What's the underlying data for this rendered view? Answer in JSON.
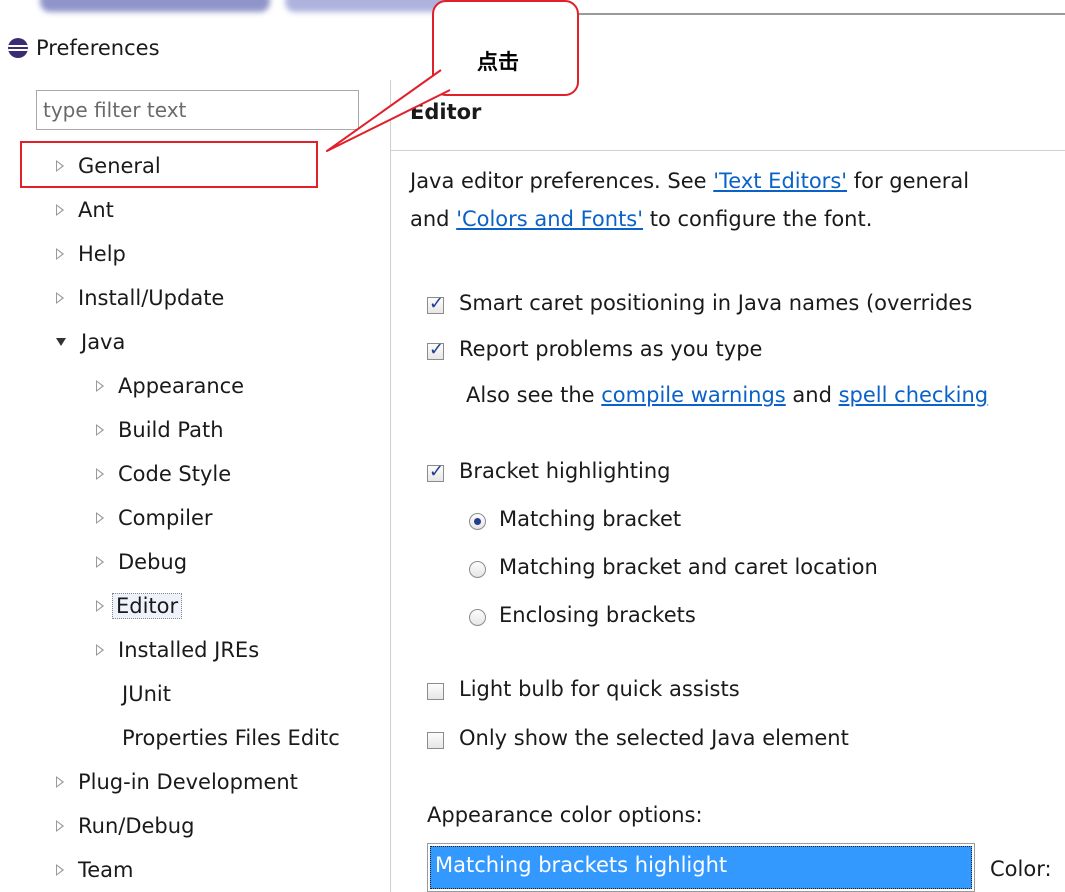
{
  "window": {
    "title": "Preferences"
  },
  "filter": {
    "placeholder": "type filter text"
  },
  "tree": {
    "general": "General",
    "ant": "Ant",
    "help": "Help",
    "install_update": "Install/Update",
    "java": "Java",
    "appearance": "Appearance",
    "build_path": "Build Path",
    "code_style": "Code Style",
    "compiler": "Compiler",
    "debug": "Debug",
    "editor": "Editor",
    "installed_jres": "Installed JREs",
    "junit": "JUnit",
    "properties_files_editor": "Properties Files Editc",
    "plugin_development": "Plug-in Development",
    "run_debug": "Run/Debug",
    "team": "Team"
  },
  "editor": {
    "heading": "Editor",
    "desc_1_prefix": "Java editor preferences. See ",
    "desc_1_link": "'Text Editors'",
    "desc_1_suffix": " for general",
    "desc_2_prefix": "and ",
    "desc_2_link": "'Colors and Fonts'",
    "desc_2_suffix": " to configure the font.",
    "smart_caret": "Smart caret positioning in Java names (overrides",
    "report_problems": "Report problems as you type",
    "also_see_prefix": "Also see the ",
    "compile_warnings": "compile warnings",
    "also_see_and": " and ",
    "spell_checking": "spell checking",
    "bracket_highlighting": "Bracket highlighting",
    "matching_bracket": "Matching bracket",
    "matching_bracket_caret": "Matching bracket and caret location",
    "enclosing_brackets": "Enclosing brackets",
    "light_bulb": "Light bulb for quick assists",
    "only_show_selected": "Only show the selected Java element",
    "appearance_color_options": "Appearance color options:",
    "selected_color_option": "Matching brackets highlight",
    "color_label": "Color:"
  },
  "states": {
    "smart_caret_checked": true,
    "report_problems_checked": true,
    "bracket_highlighting_checked": true,
    "light_bulb_checked": false,
    "only_show_selected_checked": false,
    "bracket_mode_selected": "Matching bracket"
  },
  "annotation": {
    "callout_text": "点击"
  },
  "colors": {
    "annotation_red": "#e0202a",
    "link_blue": "#0a62c8",
    "selection_blue": "#3399ff"
  }
}
